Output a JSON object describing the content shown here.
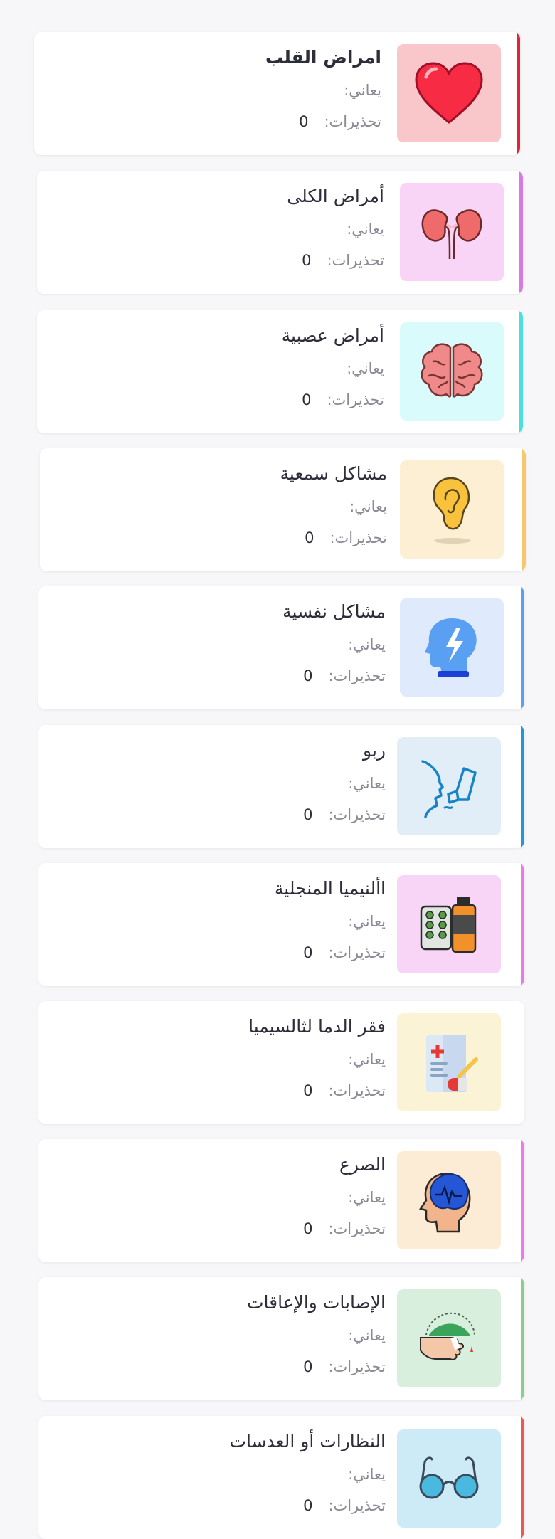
{
  "cards": [
    {
      "title": "امراض القلب",
      "meaning_label": "يعاني:",
      "warnings_label": "تحذيرات:",
      "warnings_count": "0",
      "icon": "heart-icon",
      "accent": "#e8213a",
      "thumb_bg": "#f9c7c9"
    },
    {
      "title": "أمراض الكلى",
      "meaning_label": "يعاني:",
      "warnings_label": "تحذيرات:",
      "warnings_count": "0",
      "icon": "kidneys-icon",
      "accent": "#d77be0",
      "thumb_bg": "#f8d5f6"
    },
    {
      "title": "أمراض عصبية",
      "meaning_label": "يعاني:",
      "warnings_label": "تحذيرات:",
      "warnings_count": "0",
      "icon": "brain-icon",
      "accent": "#4ce0dc",
      "thumb_bg": "#dafbfb"
    },
    {
      "title": "مشاكل سمعية",
      "meaning_label": "يعاني:",
      "warnings_label": "تحذيرات:",
      "warnings_count": "0",
      "icon": "ear-icon",
      "accent": "#f7c86a",
      "thumb_bg": "#fdefd3"
    },
    {
      "title": "مشاكل نفسية",
      "meaning_label": "يعاني:",
      "warnings_label": "تحذيرات:",
      "warnings_count": "0",
      "icon": "mental-health-icon",
      "accent": "#5c9ff0",
      "thumb_bg": "#dfeafc"
    },
    {
      "title": "ربو",
      "meaning_label": "يعاني:",
      "warnings_label": "تحذيرات:",
      "warnings_count": "0",
      "icon": "inhaler-icon",
      "accent": "#1f9ad6",
      "thumb_bg": "#e1eef7"
    },
    {
      "title": "األنيميا المنجلية",
      "meaning_label": "يعاني:",
      "warnings_label": "تحذيرات:",
      "warnings_count": "0",
      "icon": "medication-icon",
      "accent": "#e97ae8",
      "thumb_bg": "#f8d5f6"
    },
    {
      "title": "فقر الدما لثالسيميا",
      "meaning_label": "يعاني:",
      "warnings_label": "تحذيرات:",
      "warnings_count": "0",
      "icon": "prescription-icon",
      "accent": "#ffffff",
      "thumb_bg": "#fbf3d6"
    },
    {
      "title": "الصرع",
      "meaning_label": "يعاني:",
      "warnings_label": "تحذيرات:",
      "warnings_count": "0",
      "icon": "epilepsy-head-icon",
      "accent": "#ec7aec",
      "thumb_bg": "#fdecd5"
    },
    {
      "title": "الإصابات والإعاقات",
      "meaning_label": "يعاني:",
      "warnings_label": "تحذيرات:",
      "warnings_count": "0",
      "icon": "injured-hand-icon",
      "accent": "#86cf8c",
      "thumb_bg": "#d9efdd"
    },
    {
      "title": "النظارات أو العدسات",
      "meaning_label": "يعاني:",
      "warnings_label": "تحذيرات:",
      "warnings_count": "0",
      "icon": "glasses-icon",
      "accent": "#ee5753",
      "thumb_bg": "#cdebf6"
    }
  ]
}
